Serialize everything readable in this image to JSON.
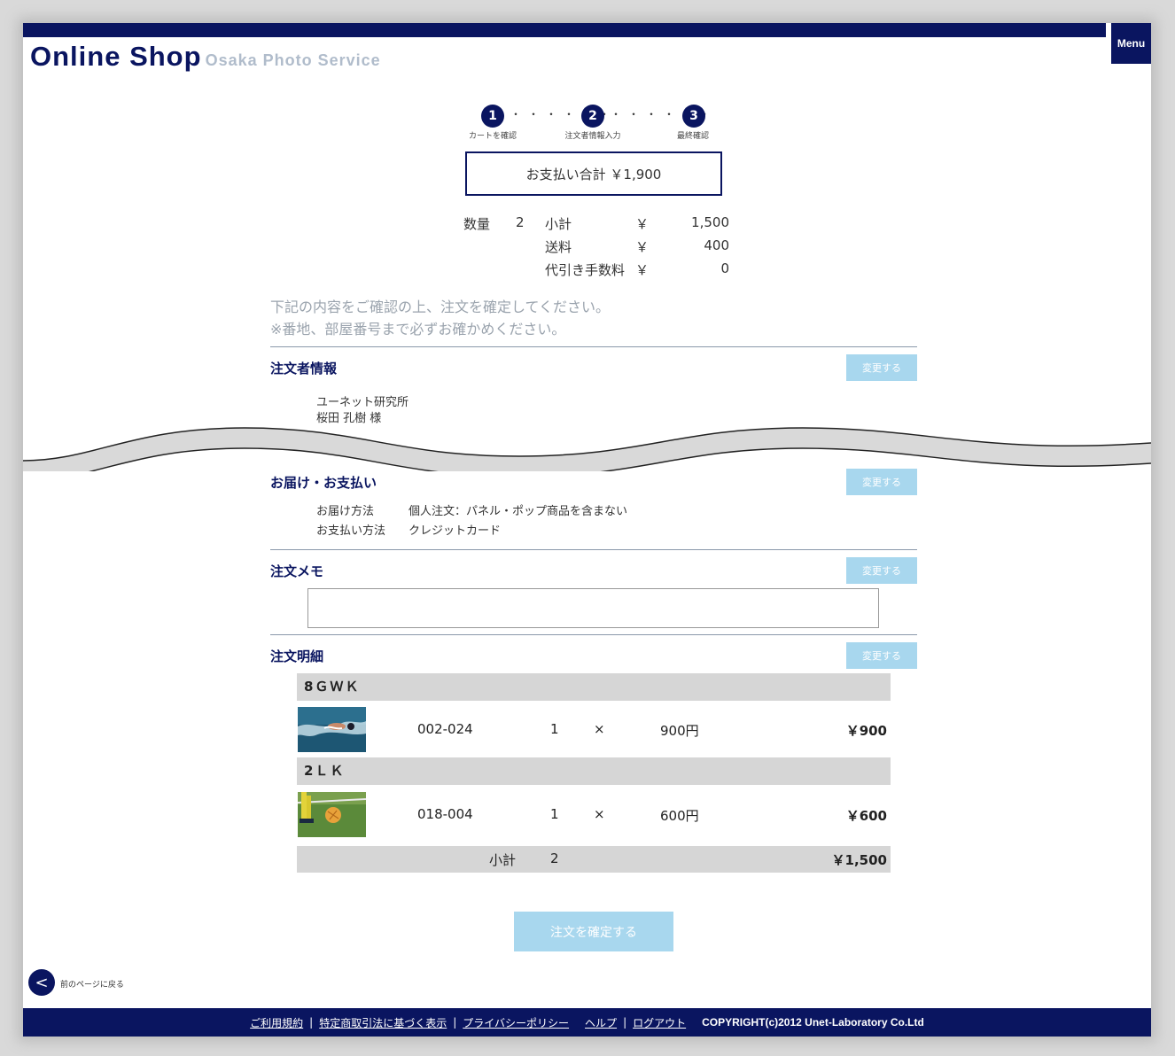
{
  "header": {
    "title": "Online Shop",
    "subtitle": "Osaka Photo Service",
    "menu_label": "Menu"
  },
  "steps": [
    {
      "number": "1",
      "label": "カートを確認"
    },
    {
      "number": "2",
      "label": "注文者情報入力"
    },
    {
      "number": "3",
      "label": "最終確認"
    }
  ],
  "steps_dots": "・・・・・・",
  "payment_total": "お支払い合計 ￥1,900",
  "summary": {
    "qty_label": "数量",
    "qty_value": "2",
    "rows": [
      {
        "label": "小計",
        "yen": "￥",
        "value": "1,500"
      },
      {
        "label": "送料",
        "yen": "￥",
        "value": "400"
      },
      {
        "label": "代引き手数料",
        "yen": "￥",
        "value": "0"
      }
    ]
  },
  "notice": {
    "line1": "下記の内容をご確認の上、注文を確定してください。",
    "line2": "※番地、部屋番号まで必ずお確かめください。"
  },
  "change_label": "変更する",
  "orderer": {
    "title": "注文者情報",
    "company": "ユーネット研究所",
    "name": "桜田 孔樹 様"
  },
  "delivery": {
    "title": "お届け・お支払い",
    "method_label": "お届け方法",
    "method_value": "個人注文：パネル・ポップ商品を含まない",
    "payment_label": "お支払い方法",
    "payment_value": "クレジットカード"
  },
  "memo": {
    "title": "注文メモ",
    "value": ""
  },
  "details": {
    "title": "注文明細",
    "groups": [
      {
        "name": "8ＧＷＫ",
        "item": {
          "code": "002-024",
          "qty": "1",
          "times": "×",
          "price": "900円",
          "amount": "￥900",
          "thumb": "swimmer-photo"
        }
      },
      {
        "name": "2ＬＫ",
        "item": {
          "code": "018-004",
          "qty": "1",
          "times": "×",
          "price": "600円",
          "amount": "￥600",
          "thumb": "soccer-photo"
        }
      }
    ],
    "subtotal_label": "小計",
    "subtotal_qty": "2",
    "subtotal_amount": "￥1,500"
  },
  "confirm_label": "注文を確定する",
  "back_label": "前のページに戻る",
  "footer": {
    "links": [
      "ご利用規約",
      "特定商取引法に基づく表示",
      "プライバシーポリシー",
      "ヘルプ",
      "ログアウト"
    ],
    "separator": "|",
    "copyright": "COPYRIGHT(c)2012 Unet-Laboratory Co.Ltd"
  },
  "colors": {
    "brand": "#0a1560",
    "button": "#a8d7ee",
    "row_bg": "#d6d6d6"
  }
}
